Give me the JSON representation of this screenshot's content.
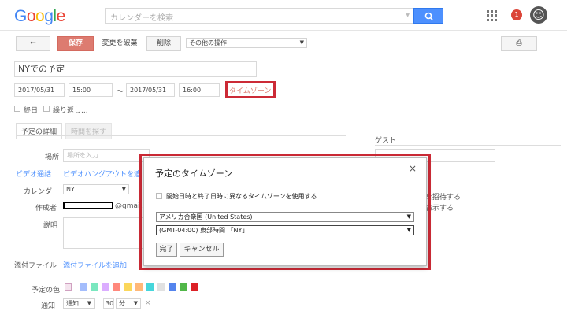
{
  "header": {
    "logo_letters": [
      {
        "ch": "G",
        "color": "#4285f4"
      },
      {
        "ch": "o",
        "color": "#ea4335"
      },
      {
        "ch": "o",
        "color": "#fbbc05"
      },
      {
        "ch": "g",
        "color": "#4285f4"
      },
      {
        "ch": "l",
        "color": "#34a853"
      },
      {
        "ch": "e",
        "color": "#ea4335"
      }
    ],
    "search_placeholder": "カレンダーを検索",
    "notification_count": "1"
  },
  "toolbar": {
    "back_arrow": "←",
    "save_label": "保存",
    "discard_label": "変更を破棄",
    "delete_label": "削除",
    "more_actions_label": "その他の操作",
    "print_icon": "⎙"
  },
  "event": {
    "title": "NYでの予定",
    "start_date": "2017/05/31",
    "start_time": "15:00",
    "separator": "～",
    "end_date": "2017/05/31",
    "end_time": "16:00",
    "timezone_link": "タイムゾーン",
    "allday_label": "終日",
    "repeat_label": "繰り返し..."
  },
  "tabs": {
    "details": "予定の詳細",
    "find_time": "時間を探す"
  },
  "form": {
    "location_label": "場所",
    "location_placeholder": "場所を入力",
    "video_label": "ビデオ通話",
    "video_link": "ビデオハングアウトを追加",
    "calendar_label": "カレンダー",
    "calendar_value": "NY",
    "creator_label": "作成者",
    "creator_email_suffix": "@gmail.c",
    "description_label": "説明",
    "attachment_label": "添付ファイル",
    "attachment_link": "添付ファイルを追加",
    "color_label": "予定の色",
    "notification_label": "通知",
    "notification_type": "通知",
    "notification_value": "30",
    "notification_unit": "分",
    "notification_remove": "×"
  },
  "guests": {
    "title": "ゲスト",
    "partial_invite": "を招待する",
    "partial_show": "表示する"
  },
  "color_swatches": [
    "#a4bdfc",
    "#7ae7bf",
    "#dbadff",
    "#ff887c",
    "#fbd75b",
    "#ffb878",
    "#46d6db",
    "#e1e1e1",
    "#5484ed",
    "#51b749",
    "#dc2127"
  ],
  "dialog": {
    "title": "予定のタイムゾーン",
    "close_icon": "×",
    "checkbox_label": "開始日時と終了日時に異なるタイムゾーンを使用する",
    "country_value": "アメリカ合衆国 (United States)",
    "timezone_value": "(GMT-04:00) 東部時間 「NY」",
    "done_label": "完了",
    "cancel_label": "キャンセル"
  },
  "colors": {
    "accent": "#4d90fe",
    "save_button": "#dd7b70",
    "highlight_border": "#cc2a36"
  }
}
